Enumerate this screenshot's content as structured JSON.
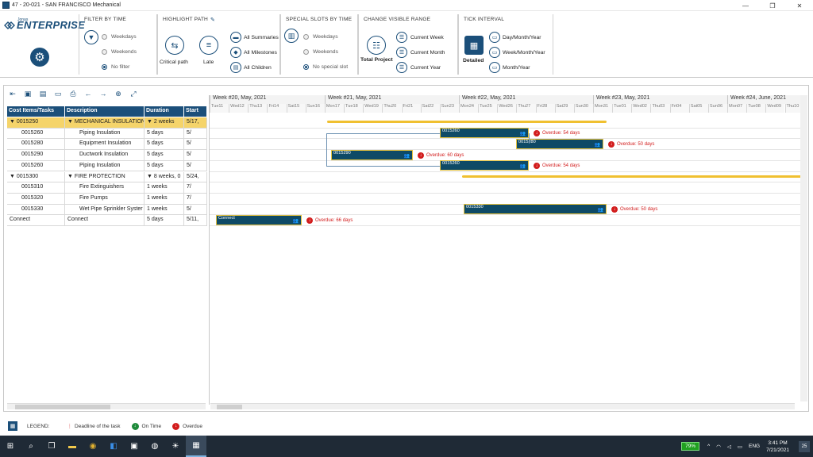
{
  "window": {
    "title": "47 - 20-021 - SAN FRANCISCO Mechanical",
    "minimize": "—",
    "restore": "❐",
    "close": "✕"
  },
  "brand": {
    "small": "Jonas",
    "name": "ENTERPRISE"
  },
  "ribbon": {
    "filter_by_time": {
      "title": "FILTER BY TIME",
      "options": [
        "Weekdays",
        "Weekends",
        "No filter"
      ],
      "selected": "No filter"
    },
    "highlight_path": {
      "title": "HIGHLIGHT PATH",
      "critical_path": "Critical path",
      "late": "Late",
      "all_summaries": "All Summaries",
      "all_milestones": "All Milestones",
      "all_children": "All Children"
    },
    "special_slots": {
      "title": "SPECIAL SLOTS BY TIME",
      "options": [
        "Weekdays",
        "Weekends",
        "No special slot"
      ],
      "selected": "No special slot"
    },
    "visible_range": {
      "title": "CHANGE VISIBLE RANGE",
      "total_project": "Total Project",
      "current_week": "Current Week",
      "current_month": "Current Month",
      "current_year": "Current Year"
    },
    "tick_interval": {
      "title": "TICK INTERVAL",
      "detailed": "Detailed",
      "day_month_year": "Day/Month/Year",
      "week_month_year": "Week/Month/Year",
      "month_year": "Month/Year"
    }
  },
  "grid": {
    "columns": [
      "Cost Items/Tasks",
      "Description",
      "Duration",
      "Start"
    ],
    "rows": [
      {
        "id": "0015250",
        "desc": "MECHANICAL INSULATION",
        "duration": "2 weeks",
        "start": "5/17,",
        "kind": "group"
      },
      {
        "id": "0015260",
        "desc": "Piping Insulation",
        "duration": "5 days",
        "start": "5/",
        "kind": "task"
      },
      {
        "id": "0015280",
        "desc": "Equipment Insulation",
        "duration": "5 days",
        "start": "5/",
        "kind": "task"
      },
      {
        "id": "0015290",
        "desc": "Ductwork Insulation",
        "duration": "5 days",
        "start": "5/",
        "kind": "task"
      },
      {
        "id": "0015260",
        "desc": "Piping Insulation",
        "duration": "5 days",
        "start": "5/",
        "kind": "task"
      },
      {
        "id": "0015300",
        "desc": "FIRE PROTECTION",
        "duration": "8 weeks, 0",
        "start": "5/24,",
        "kind": "group2"
      },
      {
        "id": "0015310",
        "desc": "Fire Extinguishers",
        "duration": "1 weeks",
        "start": "7/",
        "kind": "task"
      },
      {
        "id": "0015320",
        "desc": "Fire Pumps",
        "duration": "1 weeks",
        "start": "7/",
        "kind": "task"
      },
      {
        "id": "0015330",
        "desc": "Wet Pipe Sprinkler Syster",
        "duration": "1 weeks",
        "start": "5/",
        "kind": "task"
      },
      {
        "id": "Connect",
        "desc": "Connect",
        "duration": "5 days",
        "start": "5/11,",
        "kind": "plain"
      }
    ]
  },
  "timeline": {
    "weeks": [
      "Week #20, May, 2021",
      "Week #21, May, 2021",
      "Week #22, May, 2021",
      "Week #23, May, 2021",
      "Week #24, June, 2021"
    ],
    "days": [
      "Tue11",
      "Wed12",
      "Thu13",
      "Fri14",
      "Sat15",
      "Sun16",
      "Mon17",
      "Tue18",
      "Wed19",
      "Thu20",
      "Fri21",
      "Sat22",
      "Sun23",
      "Mon24",
      "Tue25",
      "Wed26",
      "Thu27",
      "Fri28",
      "Sat29",
      "Sun30",
      "Mon31",
      "Tue01",
      "Wed02",
      "Thu03",
      "Fri04",
      "Sat05",
      "Sun06",
      "Mon07",
      "Tue08",
      "Wed09",
      "Thu10"
    ],
    "bars": [
      {
        "label": "0015260",
        "overdue": "Overdue: 54 days"
      },
      {
        "label": "0015280",
        "overdue": "Overdue: 50 days"
      },
      {
        "label": "0015290",
        "overdue": "Overdue: 60 days"
      },
      {
        "label": "0015260",
        "overdue": "Overdue: 54 days"
      },
      {
        "label": "0015330",
        "overdue": "Overdue: 50 days"
      },
      {
        "label": "Connect",
        "overdue": "Overdue: 66 days"
      }
    ]
  },
  "legend": {
    "label": "LEGEND:",
    "deadline": "Deadline of the task",
    "on_time": "On Time",
    "overdue": "Overdue"
  },
  "taskbar": {
    "battery": "79%",
    "lang": "ENG",
    "time": "3:41 PM",
    "date": "7/21/2021",
    "notifications": "25"
  }
}
